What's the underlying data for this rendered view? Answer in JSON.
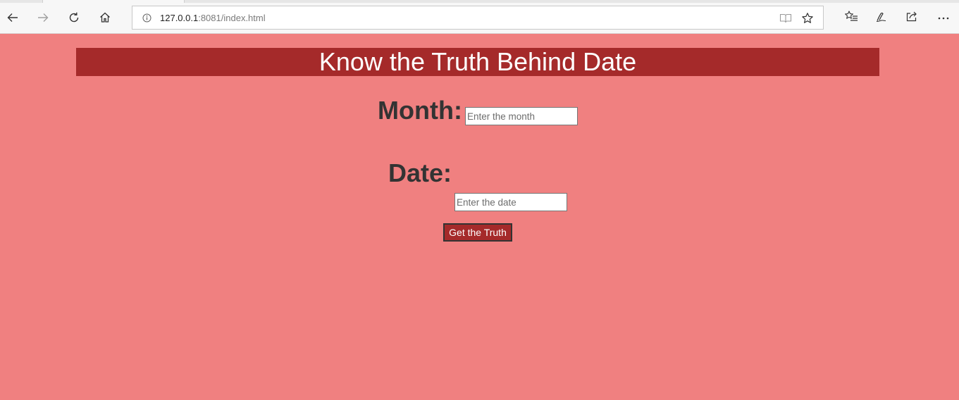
{
  "browser": {
    "url_host": "127.0.0.1",
    "url_rest": ":8081/index.html",
    "icons": {
      "back": "back-arrow-icon",
      "forward": "forward-arrow-icon",
      "refresh": "refresh-icon",
      "home": "home-icon",
      "info": "info-icon",
      "reading_view": "reading-view-icon",
      "favorite": "star-icon",
      "favorites_hub": "favorites-list-icon",
      "notes": "pen-icon",
      "share": "share-icon",
      "more": "more-dots-icon"
    }
  },
  "page": {
    "background_color": "#f08080",
    "banner_color": "#a52a2a",
    "title": "Know the Truth Behind Date",
    "month_label": "Month:",
    "month_placeholder": "Enter the month",
    "month_value": "",
    "date_label": "Date:",
    "date_placeholder": "Enter the date",
    "date_value": "",
    "submit_label": "Get the Truth"
  }
}
